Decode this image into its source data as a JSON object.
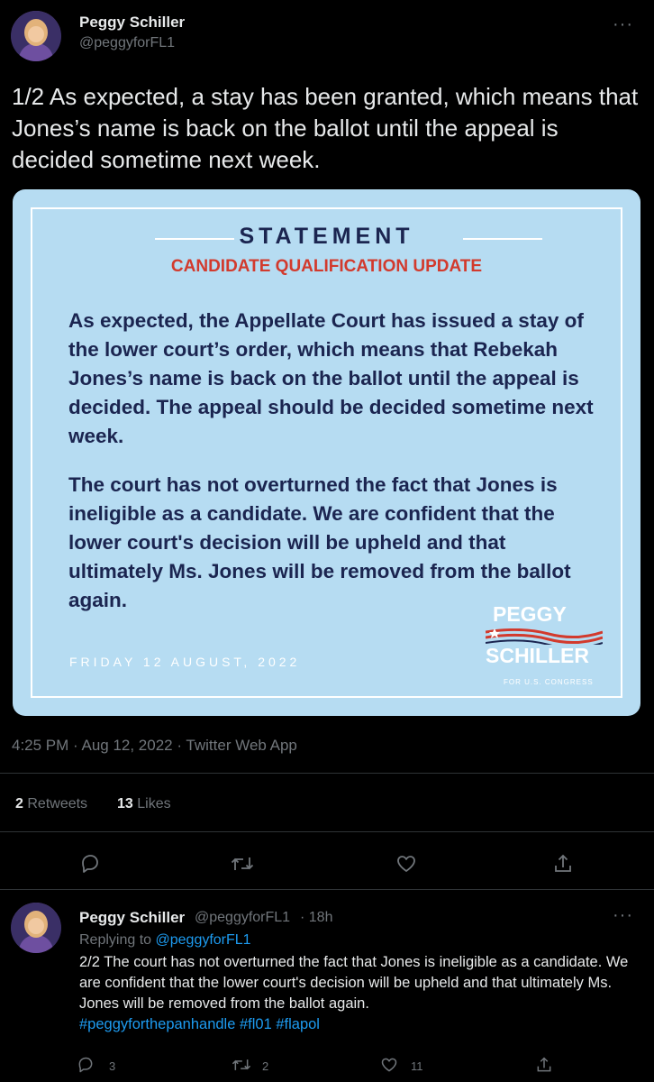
{
  "tweet": {
    "display_name": "Peggy Schiller",
    "handle": "@peggyforFL1",
    "text": "1/2 As expected, a stay has been granted, which means that Jones’s name is back on the ballot until the appeal is decided sometime next week.",
    "timestamp": "4:25 PM · Aug 12, 2022 · Twitter Web App",
    "retweets_count": "2",
    "retweets_label": "Retweets",
    "likes_count": "13",
    "likes_label": "Likes"
  },
  "statement_image": {
    "title": "STATEMENT",
    "subtitle": "CANDIDATE QUALIFICATION UPDATE",
    "paragraph1": "As expected, the Appellate Court has issued a stay of the lower court’s order, which means that Rebekah Jones’s name is back on the ballot until the appeal is decided. The appeal should be decided sometime next week.",
    "paragraph2": "The court has not overturned the fact that Jones is ineligible as a candidate. We are confident that the lower court's decision will be upheld and that ultimately Ms. Jones will be removed from the ballot again.",
    "date": "FRIDAY 12 AUGUST, 2022",
    "logo_line1": "PEGGY",
    "logo_line2": "SCHILLER",
    "logo_tagline": "FOR U.S. CONGRESS"
  },
  "reply": {
    "display_name": "Peggy Schiller",
    "handle": "@peggyforFL1",
    "time": "· 18h",
    "replying_to_label": "Replying to",
    "replying_to_handle": "@peggyforFL1",
    "text": "2/2 The court has not overturned the fact that Jones is ineligible as a candidate. We are confident that the lower court's decision will be upheld and that ultimately Ms. Jones will be removed from the ballot again.",
    "hashtags": "#peggyforthepanhandle #fl01 #flapol",
    "reply_count": "3",
    "retweet_count": "2",
    "like_count": "11"
  },
  "icons": {
    "more": "more-icon",
    "reply": "reply-icon",
    "retweet": "retweet-icon",
    "like": "heart-icon",
    "share": "share-icon"
  },
  "colors": {
    "background": "#000000",
    "text": "#e7e9ea",
    "secondary": "#71767b",
    "link": "#1d9bf0",
    "card_bg": "#b6dcf2",
    "card_navy": "#1b2550",
    "card_red": "#d23a2d"
  }
}
